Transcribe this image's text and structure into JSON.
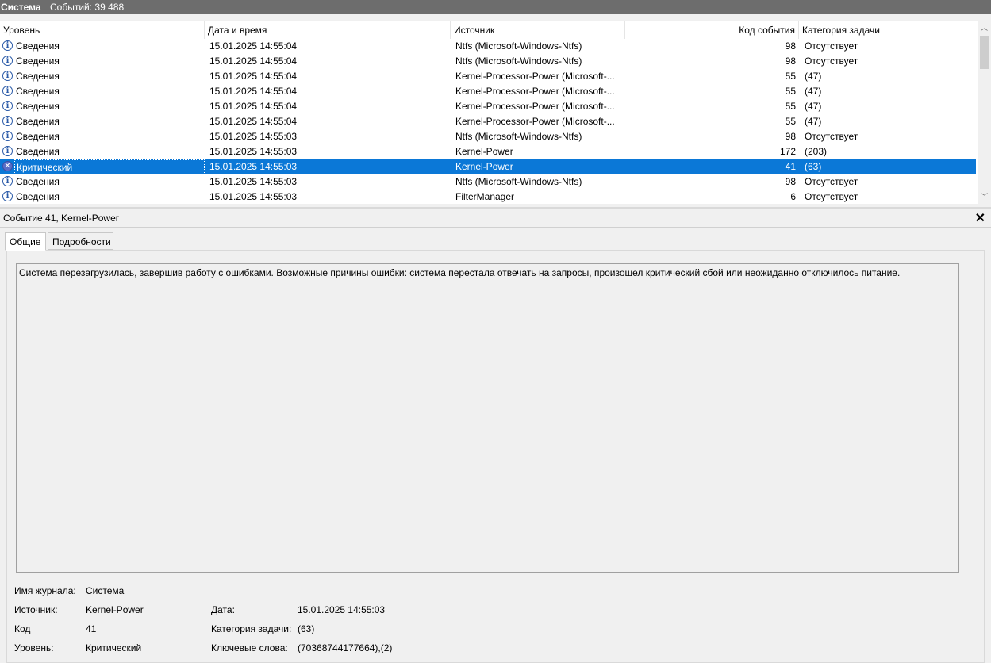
{
  "header": {
    "title": "Система",
    "count_label": "Событий: 39 488"
  },
  "grid": {
    "columns": [
      "Уровень",
      "Дата и время",
      "Источник",
      "Код события",
      "Категория задачи"
    ],
    "rows": [
      {
        "level": "Сведения",
        "icon": "info-icon",
        "datetime": "15.01.2025 14:55:04",
        "source": "Ntfs (Microsoft-Windows-Ntfs)",
        "code": "98",
        "category": "Отсутствует"
      },
      {
        "level": "Сведения",
        "icon": "info-icon",
        "datetime": "15.01.2025 14:55:04",
        "source": "Ntfs (Microsoft-Windows-Ntfs)",
        "code": "98",
        "category": "Отсутствует"
      },
      {
        "level": "Сведения",
        "icon": "info-icon",
        "datetime": "15.01.2025 14:55:04",
        "source": "Kernel-Processor-Power (Microsoft-...",
        "code": "55",
        "category": "(47)"
      },
      {
        "level": "Сведения",
        "icon": "info-icon",
        "datetime": "15.01.2025 14:55:04",
        "source": "Kernel-Processor-Power (Microsoft-...",
        "code": "55",
        "category": "(47)"
      },
      {
        "level": "Сведения",
        "icon": "info-icon",
        "datetime": "15.01.2025 14:55:04",
        "source": "Kernel-Processor-Power (Microsoft-...",
        "code": "55",
        "category": "(47)"
      },
      {
        "level": "Сведения",
        "icon": "info-icon",
        "datetime": "15.01.2025 14:55:04",
        "source": "Kernel-Processor-Power (Microsoft-...",
        "code": "55",
        "category": "(47)"
      },
      {
        "level": "Сведения",
        "icon": "info-icon",
        "datetime": "15.01.2025 14:55:03",
        "source": "Ntfs (Microsoft-Windows-Ntfs)",
        "code": "98",
        "category": "Отсутствует"
      },
      {
        "level": "Сведения",
        "icon": "info-icon",
        "datetime": "15.01.2025 14:55:03",
        "source": "Kernel-Power",
        "code": "172",
        "category": "(203)"
      },
      {
        "level": "Критический",
        "icon": "critical-icon",
        "datetime": "15.01.2025 14:55:03",
        "source": "Kernel-Power",
        "code": "41",
        "category": "(63)",
        "selected": true
      },
      {
        "level": "Сведения",
        "icon": "info-icon",
        "datetime": "15.01.2025 14:55:03",
        "source": "Ntfs (Microsoft-Windows-Ntfs)",
        "code": "98",
        "category": "Отсутствует"
      },
      {
        "level": "Сведения",
        "icon": "info-icon",
        "datetime": "15.01.2025 14:55:03",
        "source": "FilterManager",
        "code": "6",
        "category": "Отсутствует"
      }
    ]
  },
  "details": {
    "title": "Событие 41, Kernel-Power",
    "close_glyph": "✕",
    "tabs": [
      "Общие",
      "Подробности"
    ],
    "description": "Система перезагрузилась, завершив работу с ошибками. Возможные причины ошибки: система перестала отвечать на запросы, произошел критический сбой или неожиданно отключилось питание.",
    "props": {
      "log_label": "Имя журнала:",
      "log_value": "Система",
      "source_label": "Источник:",
      "source_value": "Kernel-Power",
      "date_label": "Дата:",
      "date_value": "15.01.2025 14:55:03",
      "code_label": "Код",
      "code_value": "41",
      "category_label": "Категория задачи:",
      "category_value": "(63)",
      "level_label": "Уровень:",
      "level_value": "Критический",
      "keywords_label": "Ключевые слова:",
      "keywords_value": "(70368744177664),(2)"
    }
  },
  "colors": {
    "selection": "#0b78d7",
    "topbar": "#6d6d6d"
  }
}
